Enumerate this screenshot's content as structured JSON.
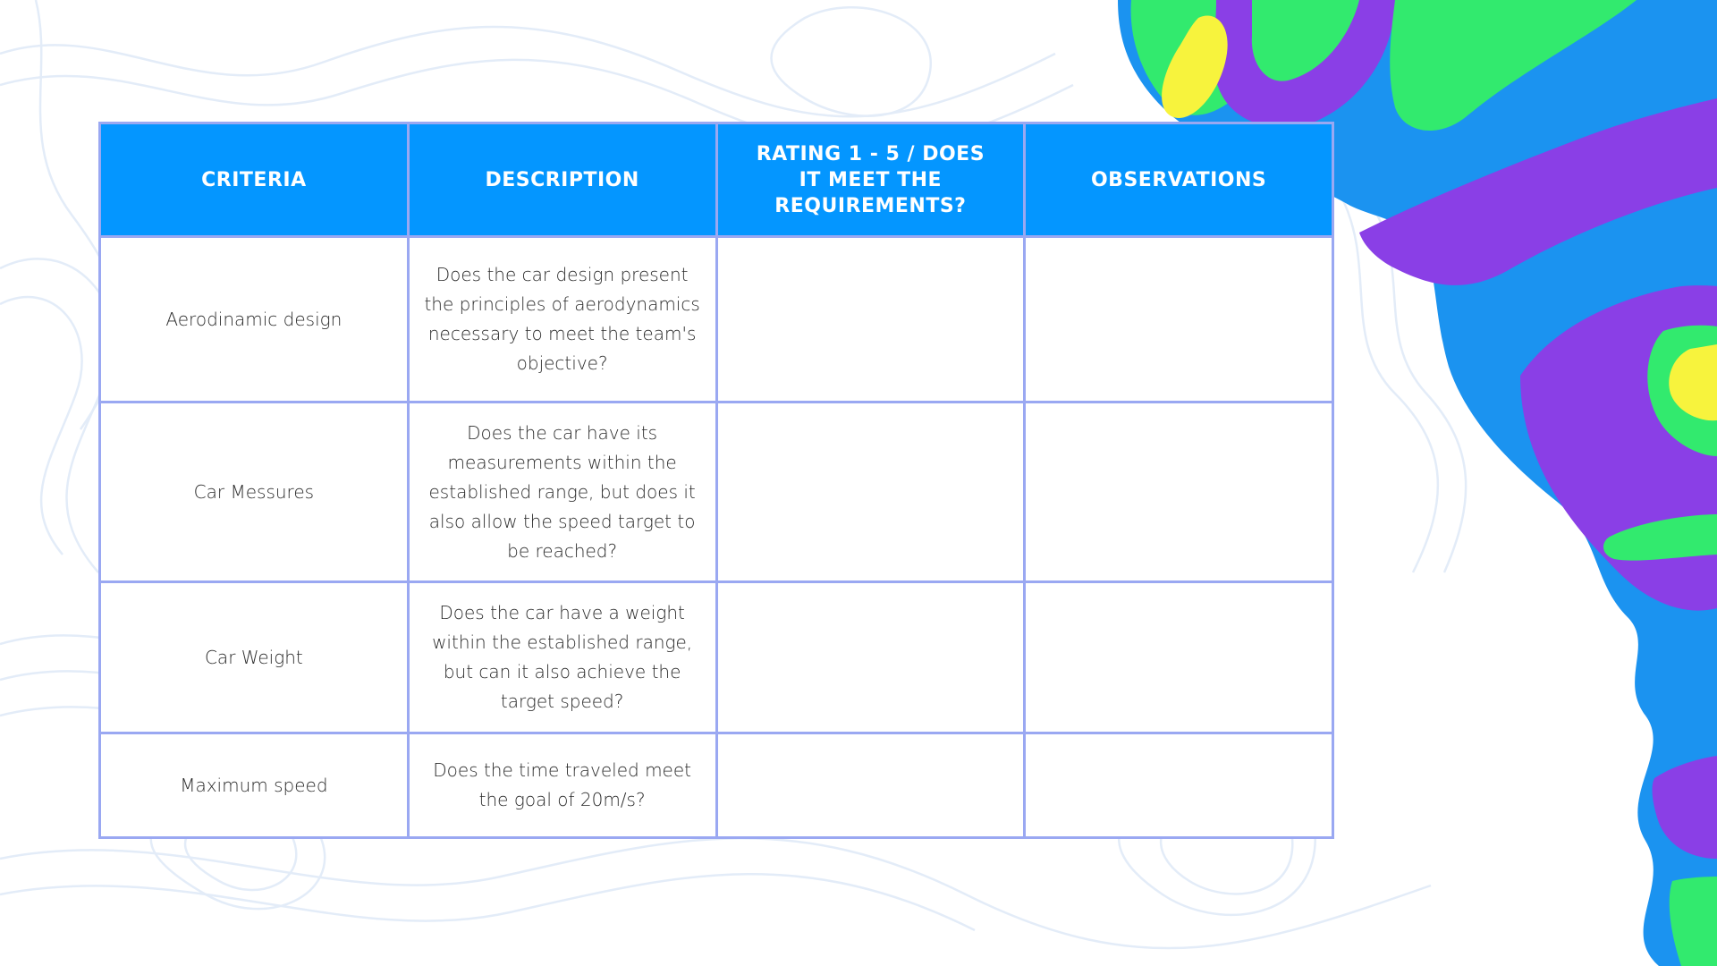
{
  "colors": {
    "header_bg": "#0496ff",
    "border": "#9aa8f2",
    "header_text": "#ffffff",
    "body_text": "#2b2b2b",
    "blob_blue": "#1b93f0",
    "blob_green": "#32ea6e",
    "blob_purple": "#8a3fe6",
    "blob_yellow": "#f7f33d",
    "pattern_lines": "#e3ecf8"
  },
  "table": {
    "headers": [
      "CRITERIA",
      "DESCRIPTION",
      "RATING 1 - 5 / DOES IT MEET THE REQUIREMENTS?",
      "OBSERVATIONS"
    ],
    "rows": [
      {
        "criteria": "Aerodinamic design",
        "description": "Does the car design present the principles of aerodynamics necessary to meet the team's objective?",
        "rating": "",
        "observations": ""
      },
      {
        "criteria": "Car Messures",
        "description": "Does the car have its measurements within the established range, but does it also allow the speed target to be reached?",
        "rating": "",
        "observations": ""
      },
      {
        "criteria": "Car Weight",
        "description": "Does the car have a weight within the established range, but can it also achieve the target speed?",
        "rating": "",
        "observations": ""
      },
      {
        "criteria": "Maximum speed",
        "description": "Does the time traveled meet the goal of 20m/s?",
        "rating": "",
        "observations": ""
      }
    ]
  }
}
